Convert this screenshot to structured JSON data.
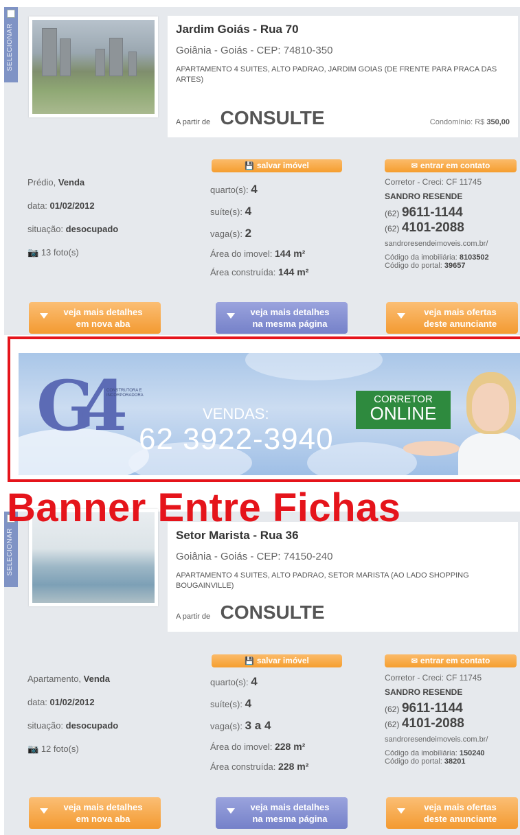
{
  "common": {
    "select_label": "SELECIONAR",
    "save_label": "salvar imóvel",
    "contact_label": "entrar em contato",
    "btn_new_tab": [
      "veja mais detalhes",
      "em nova aba"
    ],
    "btn_same_page": [
      "veja mais detalhes",
      "na mesma página"
    ],
    "btn_more_offers": [
      "veja mais ofertas",
      "deste anunciante"
    ],
    "price_prefix": "A partir de",
    "price_value": "CONSULTE",
    "label_quartos": "quarto(s):",
    "label_suites": "suíte(s):",
    "label_vagas": "vaga(s):",
    "label_area_imovel": "Área do imovel:",
    "label_area_construida": "Área construída:",
    "label_data": "data:",
    "label_situacao": "situação:",
    "broker_creci": "Corretor - Creci: CF 11745",
    "broker_name": "SANDRO RESENDE",
    "phone_ddd": "(62)",
    "phone1": "9611-1144",
    "phone2": "4101-2088",
    "website": "sandroresendeimoveis.com.br/",
    "label_cod_imob": "Código da imobiliária:",
    "label_cod_portal": "Código do portal:"
  },
  "listings": [
    {
      "title": "Jardim Goiás - Rua 70",
      "location": "Goiânia - Goiás - CEP: 74810-350",
      "description": "APARTAMENTO 4 SUITES, ALTO PADRAO, JARDIM GOIAS (DE FRENTE PARA PRACA DAS ARTES)",
      "condominio_label": "Condomínio: R$",
      "condominio_value": "350,00",
      "type": "Prédio,",
      "deal": "Venda",
      "date": "01/02/2012",
      "status": "desocupado",
      "photos": "13 foto(s)",
      "quartos": "4",
      "suites": "4",
      "vagas": "2",
      "area_imovel": "144 m²",
      "area_construida": "144 m²",
      "cod_imob": "8103502",
      "cod_portal": "39657"
    },
    {
      "title": "Setor Marista - Rua 36",
      "location": "Goiânia - Goiás - CEP: 74150-240",
      "description": "APARTAMENTO 4 SUITES, ALTO PADRAO, SETOR MARISTA (AO LADO SHOPPING BOUGAINVILLE)",
      "type": "Apartamento,",
      "deal": "Venda",
      "date": "01/02/2012",
      "status": "desocupado",
      "photos": "12 foto(s)",
      "quartos": "4",
      "suites": "4",
      "vagas": "3 a 4",
      "area_imovel": "228 m²",
      "area_construida": "228 m²",
      "cod_imob": "150240",
      "cod_portal": "38201"
    }
  ],
  "banner": {
    "logo_text": "CONSTRUTORA E INCORPORADORA",
    "vendas_label": "VENDAS:",
    "vendas_phone": "62 3922-3940",
    "corretor_line1": "CORRETOR",
    "corretor_line2": "ONLINE"
  },
  "overlay_label": "Banner Entre Fichas",
  "colors": {
    "card_bg": "#e6e9ed",
    "orange": "#f59e2f",
    "purple": "#7581c9",
    "red": "#e5141b"
  }
}
